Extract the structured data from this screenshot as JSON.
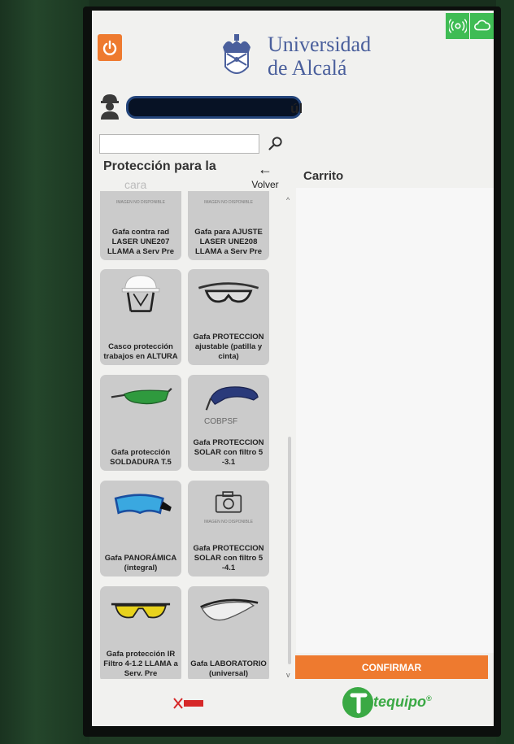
{
  "header": {
    "university_line1": "Universidad",
    "university_line2": "de Alcalá",
    "power_icon": "power-icon",
    "status_icons": [
      "signal-icon",
      "cloud-icon"
    ]
  },
  "user": {
    "name_suffix": "úl"
  },
  "search": {
    "placeholder": "",
    "value": ""
  },
  "catalog": {
    "title": "Protección para la",
    "title_line2": "cara",
    "back_label": "Volver",
    "products": [
      {
        "label": "Gafa contra rad LASER UNE207 LLAMA a Serv Pre",
        "image": "no-image",
        "image_caption": "IMAGEN NO DISPONIBLE"
      },
      {
        "label": "Gafa para AJUSTE LASER UNE208 LLAMA a Serv Pre",
        "image": "no-image",
        "image_caption": "IMAGEN NO DISPONIBLE"
      },
      {
        "label": "Casco protección trabajos en ALTURA",
        "image": "helmet"
      },
      {
        "label": "Gafa PROTECCION ajustable (patilla y cinta)",
        "image": "goggles-strap"
      },
      {
        "label": "Gafa protección SOLDADURA T.5",
        "image": "welding-glasses"
      },
      {
        "label": "Gafa PROTECCION SOLAR con filtro 5 -3.1",
        "image": "sun-glasses",
        "image_caption": "COBPSF"
      },
      {
        "label": "Gafa PANORÁMICA (integral)",
        "image": "panoramic-goggles"
      },
      {
        "label": "Gafa PROTECCION SOLAR con filtro 5 -4.1",
        "image": "no-image",
        "image_caption": "IMAGEN NO DISPONIBLE"
      },
      {
        "label": "Gafa protección IR Filtro 4-1.2 LLAMA a Serv. Pre",
        "image": "ir-glasses"
      },
      {
        "label": "Gafa LABORATORIO (universal)",
        "image": "lab-glasses"
      }
    ]
  },
  "cart": {
    "title": "Carrito",
    "confirm_label": "CONFIRMAR"
  },
  "footer": {
    "brand": "tequipo",
    "brand_mark": "®"
  },
  "colors": {
    "accent": "#ee7a2f",
    "status_green": "#3fbc54",
    "brand_green": "#3aa944",
    "university_blue": "#4a5f9c"
  }
}
